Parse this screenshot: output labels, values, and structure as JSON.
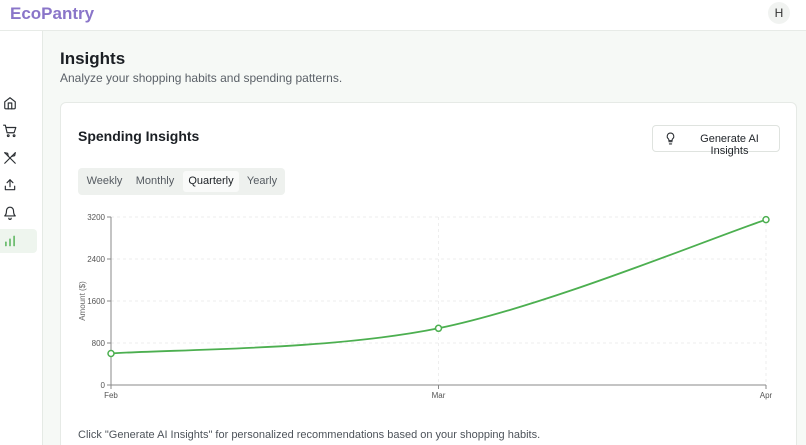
{
  "app": {
    "brand": "EcoPantry",
    "avatar_initial": "H"
  },
  "sidebar": {
    "items": [
      {
        "name": "home",
        "icon": "home-icon",
        "active": false
      },
      {
        "name": "cart",
        "icon": "cart-icon",
        "active": false
      },
      {
        "name": "recipes",
        "icon": "utensils-icon",
        "active": false
      },
      {
        "name": "share",
        "icon": "share-icon",
        "active": false
      },
      {
        "name": "notifications",
        "icon": "bell-icon",
        "active": false
      },
      {
        "name": "insights",
        "icon": "bar-chart-icon",
        "active": true
      }
    ]
  },
  "page": {
    "title": "Insights",
    "subtitle": "Analyze your shopping habits and spending patterns."
  },
  "card": {
    "title": "Spending Insights",
    "ai_button_label": "Generate AI Insights",
    "tabs": [
      "Weekly",
      "Monthly",
      "Quarterly",
      "Yearly"
    ],
    "active_tab": "Quarterly",
    "footnote": "Click \"Generate AI Insights\" for personalized recommendations based on your shopping habits."
  },
  "colors": {
    "accent": "#4caf50",
    "brand": "#8a75c9"
  },
  "chart_data": {
    "type": "line",
    "categories": [
      "Feb",
      "Mar",
      "Apr"
    ],
    "series": [
      {
        "values": [
          600,
          1080,
          3150
        ]
      }
    ],
    "ylabel": "Amount ($)",
    "yticks": [
      0,
      800,
      1600,
      2400,
      3200
    ],
    "ylim": [
      0,
      3200
    ],
    "grid": true,
    "color": "#4caf50"
  }
}
